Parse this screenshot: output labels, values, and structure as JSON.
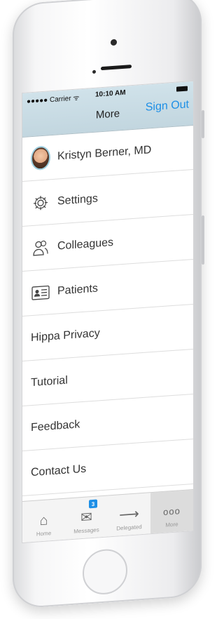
{
  "status": {
    "carrier": "●●●●● Carrier ᯤ",
    "time": "10:10 AM"
  },
  "nav": {
    "title": "More",
    "sign_out": "Sign Out"
  },
  "menu": [
    {
      "label": "Kristyn Berner, MD",
      "icon": "avatar"
    },
    {
      "label": "Settings",
      "icon": "gear-icon"
    },
    {
      "label": "Colleagues",
      "icon": "people-icon"
    },
    {
      "label": "Patients",
      "icon": "id-card-icon"
    },
    {
      "label": "Hippa Privacy",
      "icon": ""
    },
    {
      "label": "Tutorial",
      "icon": ""
    },
    {
      "label": "Feedback",
      "icon": ""
    },
    {
      "label": "Contact Us",
      "icon": ""
    }
  ],
  "tabs": [
    {
      "label": "Home",
      "icon": "home-icon"
    },
    {
      "label": "Messages",
      "icon": "envelope-icon",
      "badge": "3"
    },
    {
      "label": "Delegated",
      "icon": "arrow-right-icon"
    },
    {
      "label": "More",
      "icon": "more-icon"
    }
  ],
  "colors": {
    "accent": "#1d8fe6",
    "topbar": "#c9dce4"
  }
}
